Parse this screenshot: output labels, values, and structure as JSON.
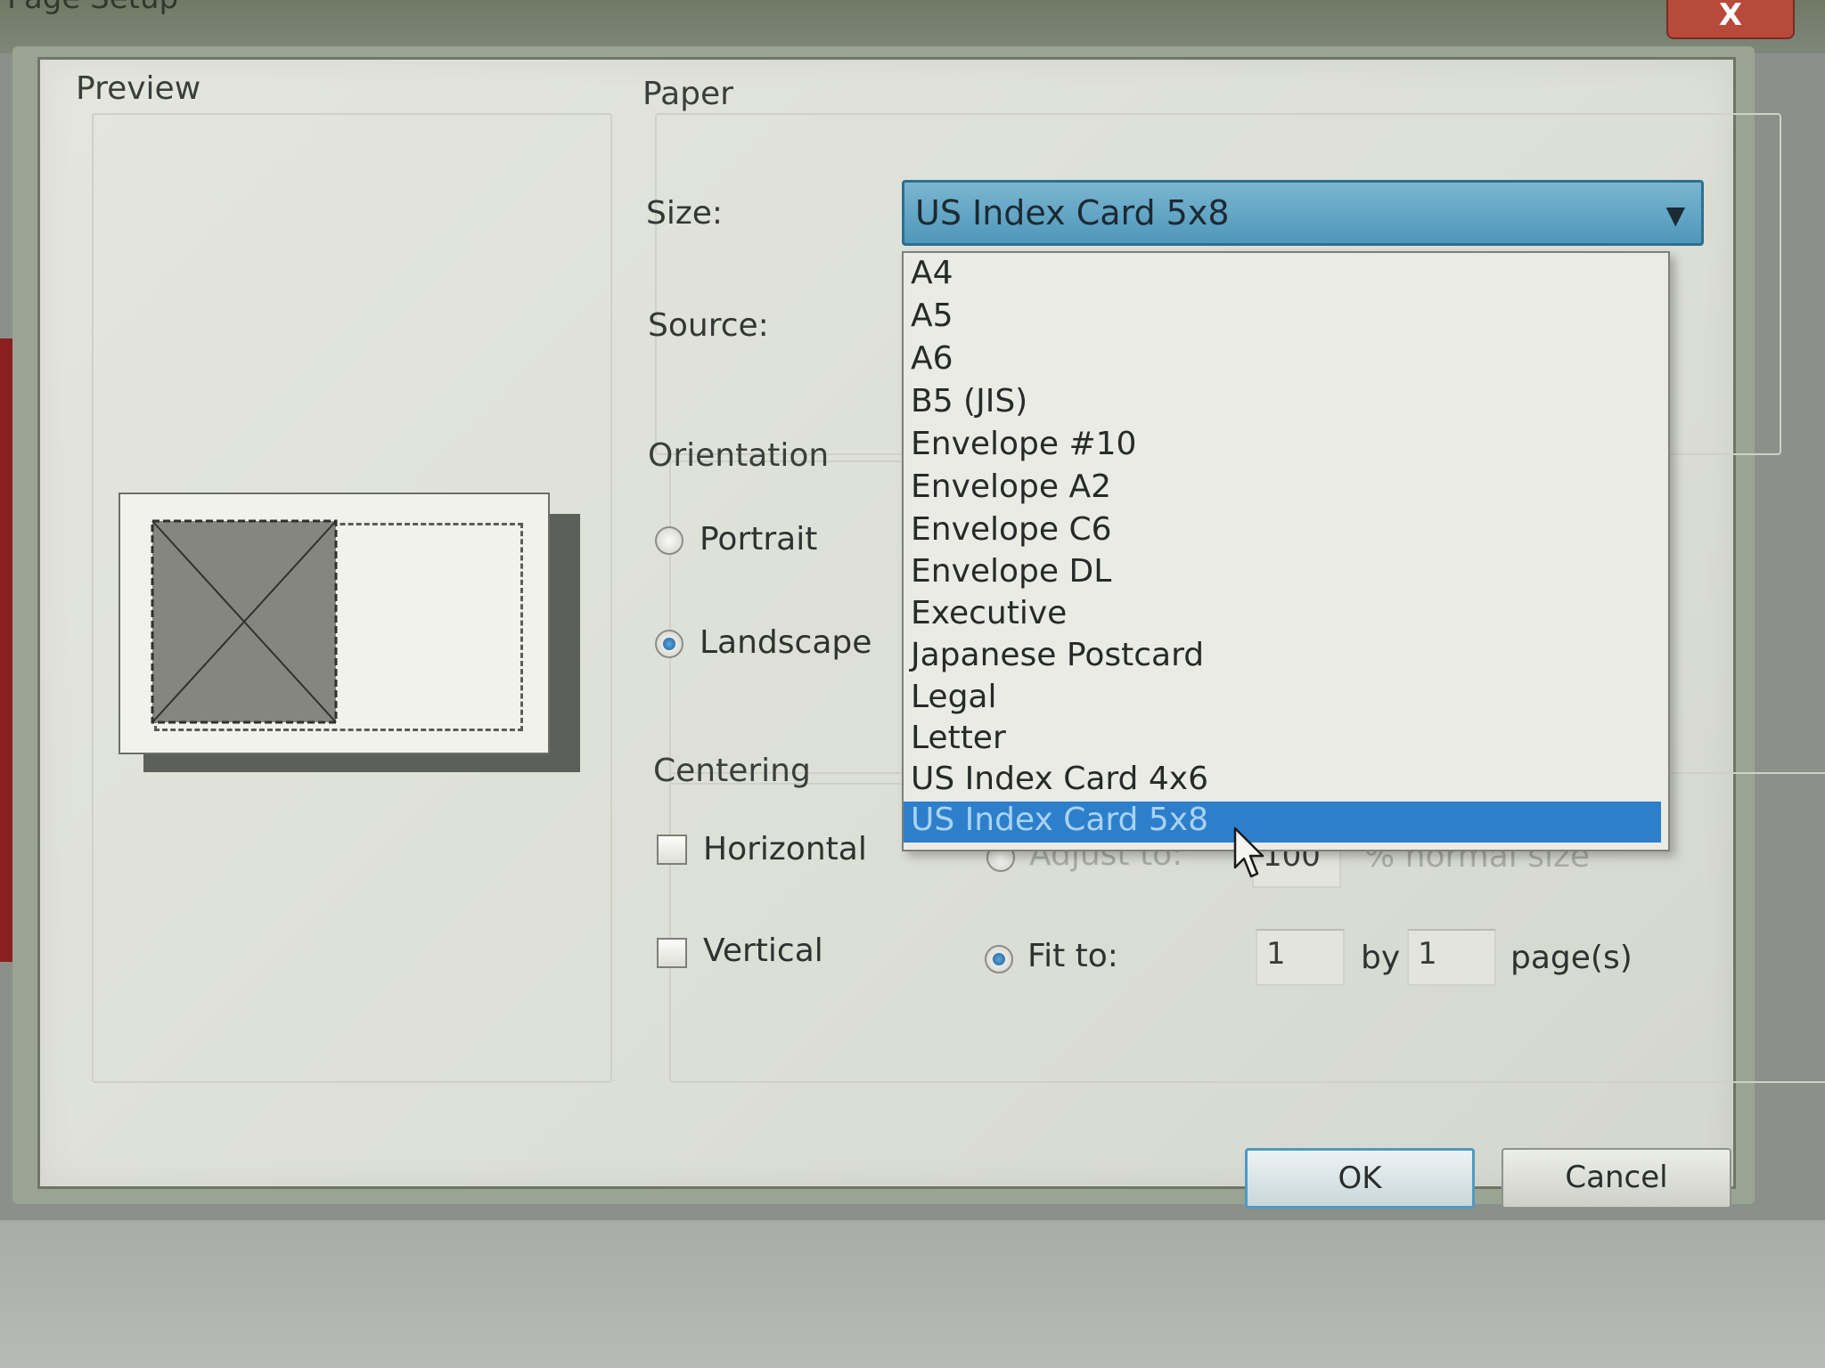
{
  "window": {
    "title": "Page Setup",
    "close_glyph": "X"
  },
  "preview": {
    "label": "Preview"
  },
  "paper": {
    "label": "Paper",
    "size_label": "Size:",
    "size_value": "US Index Card 5x8",
    "source_label": "Source:",
    "size_options": [
      "A4",
      "A5",
      "A6",
      "B5 (JIS)",
      "Envelope #10",
      "Envelope A2",
      "Envelope C6",
      "Envelope DL",
      "Executive",
      "Japanese Postcard",
      "Legal",
      "Letter",
      "US Index Card 4x6",
      "US Index Card 5x8"
    ],
    "selected_option": "US Index Card 5x8"
  },
  "orientation": {
    "label": "Orientation",
    "portrait_label": "Portrait",
    "landscape_label": "Landscape",
    "selected": "Landscape"
  },
  "centering": {
    "label": "Centering",
    "horizontal_label": "Horizontal",
    "vertical_label": "Vertical"
  },
  "scaling": {
    "adjust_to_label": "Adjust to:",
    "adjust_value": "100",
    "normal_size_label": "% normal size",
    "fit_to_label": "Fit to:",
    "fit_wide": "1",
    "by_label": "by",
    "fit_tall": "1",
    "pages_label": "page(s)",
    "selected": "Fit to"
  },
  "buttons": {
    "ok": "OK",
    "cancel": "Cancel"
  },
  "colors": {
    "selection": "#2d7fcb",
    "select_field": "#5aa3c6"
  }
}
